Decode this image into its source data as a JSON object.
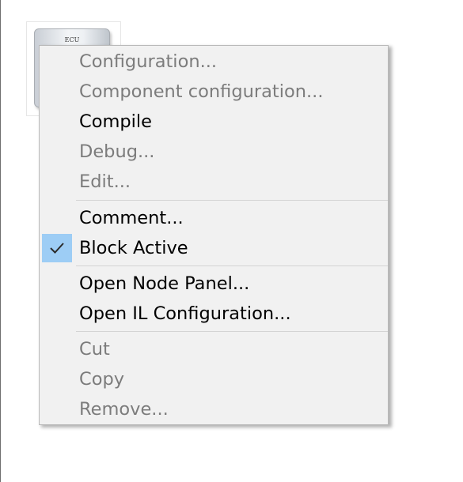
{
  "block": {
    "label": "ECU"
  },
  "context_menu": {
    "items": [
      {
        "label": "Configuration...",
        "enabled": false
      },
      {
        "label": "Component configuration...",
        "enabled": false
      },
      {
        "label": "Compile",
        "enabled": true
      },
      {
        "label": "Debug...",
        "enabled": false
      },
      {
        "label": "Edit...",
        "enabled": false
      },
      {
        "label": "Comment...",
        "enabled": true
      },
      {
        "label": "Block Active",
        "enabled": true,
        "checked": true
      },
      {
        "label": "Open Node Panel...",
        "enabled": true
      },
      {
        "label": "Open IL Configuration...",
        "enabled": true
      },
      {
        "label": "Cut",
        "enabled": false
      },
      {
        "label": "Copy",
        "enabled": false
      },
      {
        "label": "Remove...",
        "enabled": false
      }
    ]
  },
  "icons": {
    "checkmark": "check-icon"
  },
  "colors": {
    "menu_background": "#f1f1f1",
    "check_highlight": "#9dcdf5",
    "disabled_text": "#7c7c7c",
    "enabled_text": "#000000"
  }
}
